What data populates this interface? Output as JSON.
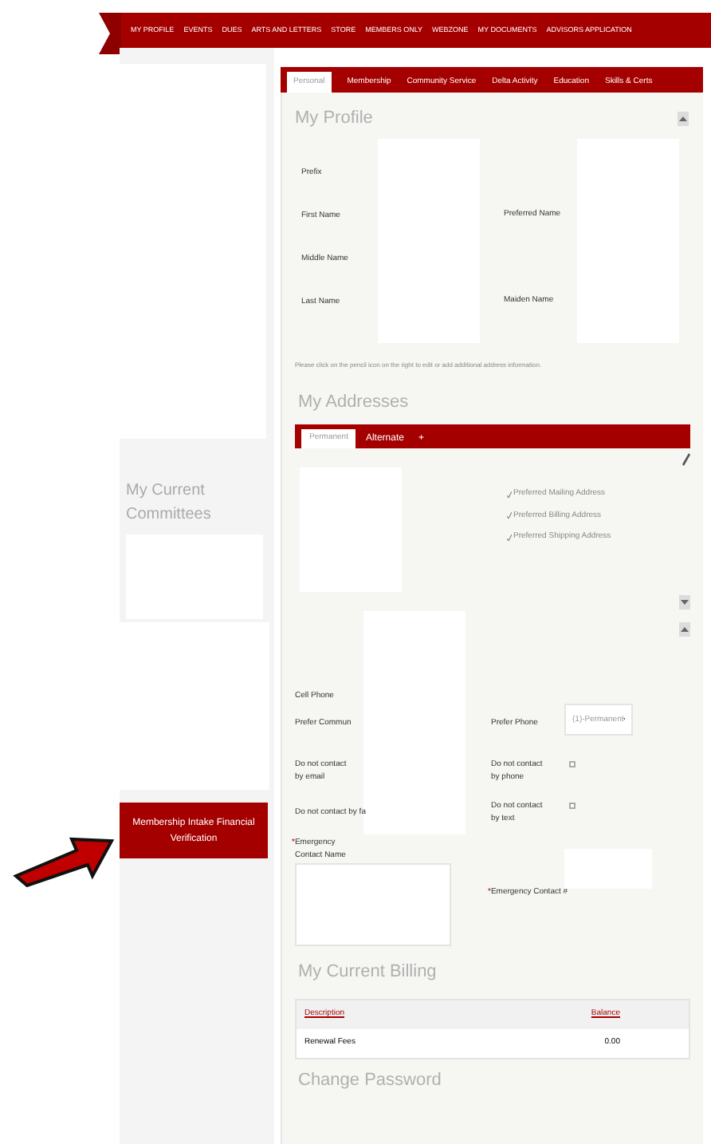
{
  "nav": [
    "MY PROFILE",
    "EVENTS",
    "DUES",
    "ARTS AND LETTERS",
    "STORE",
    "MEMBERS ONLY",
    "WEBZONE",
    "MY DOCUMENTS",
    "ADVISORS APPLICATION"
  ],
  "sidebar": {
    "committees_title": "My Current Committees",
    "button": "Membership Intake Financial Verification"
  },
  "tabs": [
    {
      "label": "Personal",
      "selected": true
    },
    {
      "label": "Membership",
      "selected": false
    },
    {
      "label": "Community Service",
      "selected": false
    },
    {
      "label": "Delta Activity",
      "selected": false
    },
    {
      "label": "Education",
      "selected": false
    },
    {
      "label": "Skills & Certs",
      "selected": false
    }
  ],
  "profile": {
    "title": "My Profile",
    "left_fields": [
      "Prefix",
      "First Name",
      "Middle Name",
      "Last Name"
    ],
    "right_fields": [
      "Preferred Name",
      "Maiden Name"
    ]
  },
  "note": "Please click on the pencil icon on the right to edit or add additional address information.",
  "addresses": {
    "title": "My Addresses",
    "tabs": [
      {
        "label": "Permanent",
        "selected": true
      },
      {
        "label": "Alternate",
        "selected": false
      }
    ],
    "add_tab": "+",
    "preferences": [
      {
        "label": "Preferred Mailing Address",
        "checked": true
      },
      {
        "label": "Preferred Billing Address",
        "checked": true
      },
      {
        "label": "Preferred Shipping Address",
        "checked": true
      }
    ]
  },
  "contact": {
    "cell_phone": "Cell Phone",
    "prefer_commun": "Prefer Commun",
    "prefer_phone": {
      "label": "Prefer Phone",
      "value": "(1)-Permanent"
    },
    "no_email": "Do not contact by email",
    "no_phone": {
      "label": "Do not contact by phone",
      "checked": false
    },
    "no_fax": "Do not contact by fa",
    "no_text": {
      "label": "Do not contact by text",
      "checked": false
    },
    "required_mark": "*",
    "emergency_name": "Emergency Contact Name",
    "emergency_number": "Emergency Contact #"
  },
  "billing": {
    "title": "My Current Billing",
    "columns": [
      "Description",
      "Balance"
    ],
    "rows": [
      [
        "Renewal Fees",
        "0.00"
      ]
    ]
  },
  "next_section": "Change Password"
}
